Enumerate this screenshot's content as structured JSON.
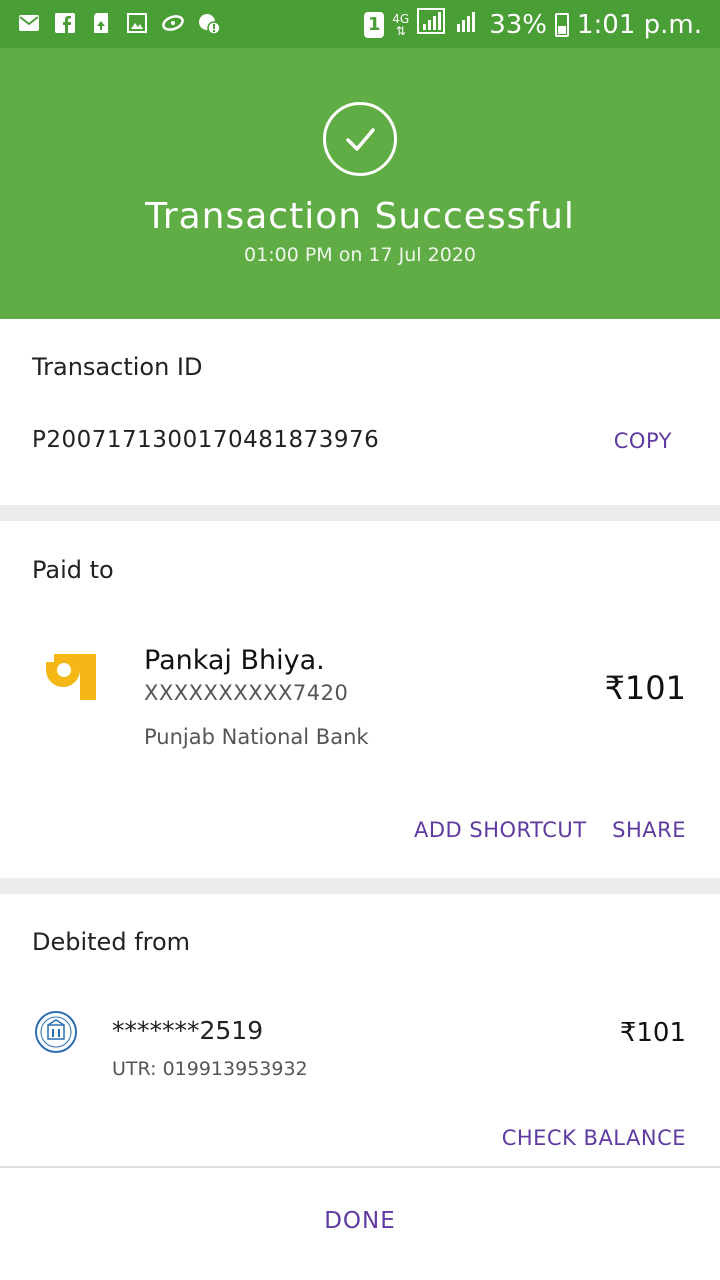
{
  "status_bar": {
    "sim": "1",
    "network": "4G",
    "battery": "33%",
    "time": "1:01 p.m.",
    "left_icons": [
      "mail-icon",
      "facebook-icon",
      "sd-card-icon",
      "gallery-icon",
      "link-icon",
      "alert-icon"
    ]
  },
  "header": {
    "title": "Transaction Successful",
    "subtitle": "01:00 PM on 17 Jul 2020"
  },
  "transaction": {
    "label": "Transaction ID",
    "id": "P2007171300170481873976",
    "copy_label": "COPY"
  },
  "paid_to": {
    "label": "Paid to",
    "name": "Pankaj Bhiya.",
    "account": "XXXXXXXXXX7420",
    "bank": "Punjab National Bank",
    "amount": "₹101",
    "add_shortcut_label": "ADD SHORTCUT",
    "share_label": "SHARE"
  },
  "debited_from": {
    "label": "Debited from",
    "account": "*******2519",
    "utr": "UTR: 019913953932",
    "amount": "₹101",
    "check_balance_label": "CHECK BALANCE"
  },
  "footer": {
    "done_label": "DONE"
  },
  "colors": {
    "status_bar": "#4a9e36",
    "header": "#60ad45",
    "accent": "#5f3aa0",
    "pnb_yellow": "#f4b715"
  }
}
